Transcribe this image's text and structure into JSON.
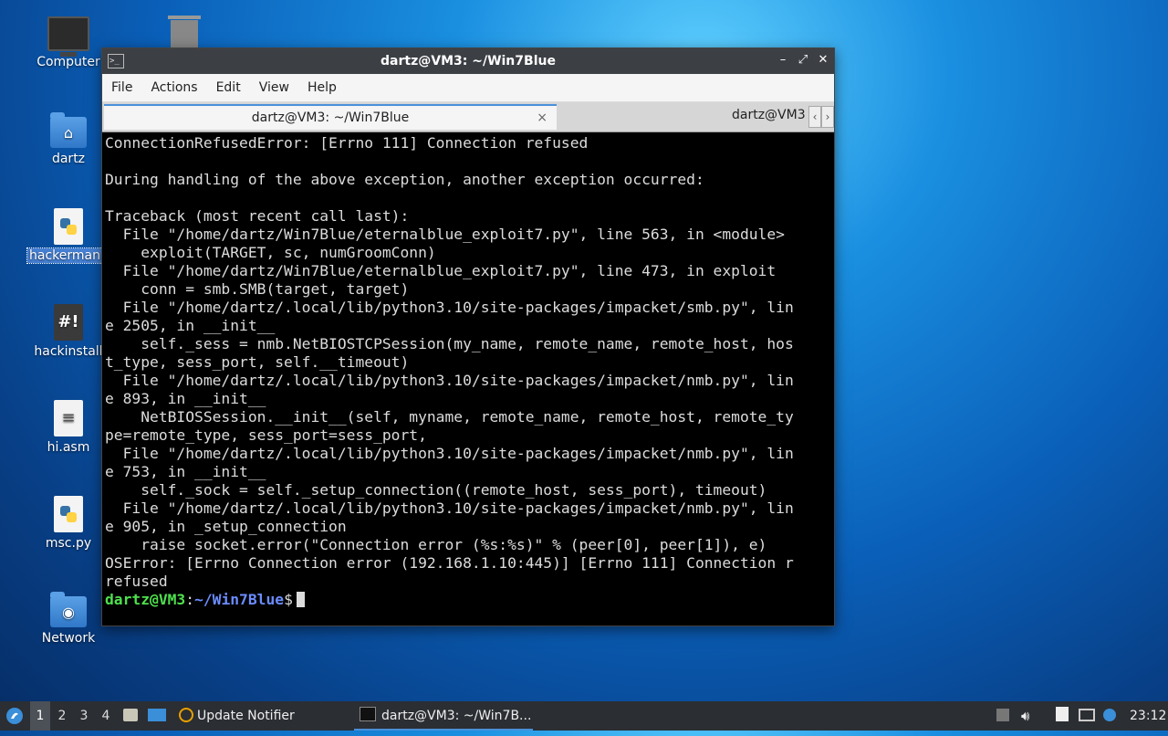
{
  "desktop": {
    "icons": [
      {
        "label": "Computer"
      },
      {
        "label": "dartz"
      },
      {
        "label": "hackerman.py"
      },
      {
        "label": "hackinstall"
      },
      {
        "label": "hi.asm"
      },
      {
        "label": "msc.py"
      },
      {
        "label": "Network"
      }
    ]
  },
  "window": {
    "title": "dartz@VM3: ~/Win7Blue",
    "controls": {
      "minimize": "–",
      "maximize": "⤢",
      "close": "✕"
    },
    "menu": [
      "File",
      "Actions",
      "Edit",
      "View",
      "Help"
    ],
    "tabs": [
      {
        "label": "dartz@VM3: ~/Win7Blue",
        "close": "×"
      },
      {
        "label": "dartz@VM3"
      }
    ],
    "tab_scroll": {
      "left": "‹",
      "right": "›"
    }
  },
  "terminal": {
    "output": "ConnectionRefusedError: [Errno 111] Connection refused\n\nDuring handling of the above exception, another exception occurred:\n\nTraceback (most recent call last):\n  File \"/home/dartz/Win7Blue/eternalblue_exploit7.py\", line 563, in <module>\n    exploit(TARGET, sc, numGroomConn)\n  File \"/home/dartz/Win7Blue/eternalblue_exploit7.py\", line 473, in exploit\n    conn = smb.SMB(target, target)\n  File \"/home/dartz/.local/lib/python3.10/site-packages/impacket/smb.py\", lin\ne 2505, in __init__\n    self._sess = nmb.NetBIOSTCPSession(my_name, remote_name, remote_host, hos\nt_type, sess_port, self.__timeout)\n  File \"/home/dartz/.local/lib/python3.10/site-packages/impacket/nmb.py\", lin\ne 893, in __init__\n    NetBIOSSession.__init__(self, myname, remote_name, remote_host, remote_ty\npe=remote_type, sess_port=sess_port,\n  File \"/home/dartz/.local/lib/python3.10/site-packages/impacket/nmb.py\", lin\ne 753, in __init__\n    self._sock = self._setup_connection((remote_host, sess_port), timeout)\n  File \"/home/dartz/.local/lib/python3.10/site-packages/impacket/nmb.py\", lin\ne 905, in _setup_connection\n    raise socket.error(\"Connection error (%s:%s)\" % (peer[0], peer[1]), e)\nOSError: [Errno Connection error (192.168.1.10:445)] [Errno 111] Connection r\nrefused",
    "prompt_user": "dartz@VM3",
    "prompt_sep": ":",
    "prompt_path": "~/Win7Blue",
    "prompt_sym": "$"
  },
  "taskbar": {
    "workspaces": [
      "1",
      "2",
      "3",
      "4"
    ],
    "windows": [
      {
        "label": "Update Notifier"
      },
      {
        "label": "dartz@VM3: ~/Win7B..."
      }
    ],
    "clock": "23:12"
  },
  "colors": {
    "prompt_user": "#4ee04e",
    "prompt_path": "#6b8cff",
    "accent": "#4a90d9"
  }
}
